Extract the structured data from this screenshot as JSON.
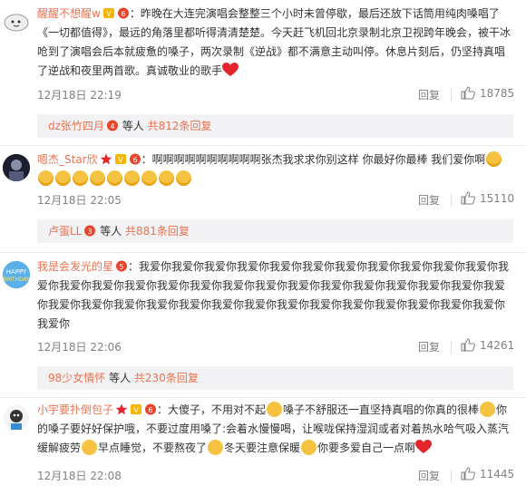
{
  "comments": [
    {
      "user": "醒醒不想醒w",
      "text1": "：昨晚在大连完演唱会整整三个小时未曾停歇，最后还放下话筒用纯肉嗓唱了《一切都值得》，最远的角落里都听得清清楚楚。今天赶飞机回北京录制北京卫视跨年晚会，被干冰呛到了演唱会后本就疲惫的嗓子，两次录制《逆战》都不满意主动叫停。休息片刻后，仍坚持真唱了逆战和夜里两首歌。真诚敬业的歌手",
      "time": "12月18日 22:19",
      "reply": "回复",
      "likes": "18785",
      "sub": {
        "name": "dz张竹四月",
        "mid": " 等人 ",
        "count": "共812条回复"
      }
    },
    {
      "user": "嗯杰_Star欣",
      "text1": "：啊啊啊啊啊啊啊啊啊啊张杰我求求你别这样 你最好你最棒 我们爱你啊",
      "time": "12月18日 22:05",
      "reply": "回复",
      "likes": "15110",
      "sub": {
        "name": "卢蛋LL",
        "mid": " 等人 ",
        "count": "共881条回复"
      }
    },
    {
      "user": "我是会发光的星",
      "text1": "：我爱你我爱你我爱你我爱你我爱你我爱你我爱你我爱你我爱你我爱你我爱你我爱你我爱你我爱你我爱你我爱你我爱你我爱你我爱你我爱你我爱你我爱你我爱你我爱你我爱你我爱你我爱你我爱你我爱你我爱你我爱你我爱你我爱你我爱你我爱你我爱你我爱你我爱你我爱你我爱你我爱你",
      "time": "12月18日 22:06",
      "reply": "回复",
      "likes": "14261",
      "sub": {
        "name": "98少女情怀",
        "mid": " 等人 ",
        "count": "共230条回复"
      }
    },
    {
      "user": "小宇要扑倒包子",
      "text1": "：大傻子，不用对不起",
      "text2": "嗓子不舒服还一直坚持真唱的你真的很棒",
      "text3": "你的嗓子要好好保护哦，不要过度用嗓了:会着水慢慢喝，让喉咙保持湿润或者对着热水哈气吸入蒸汽缓解疲劳",
      "text4": "早点睡觉，不要熬夜了",
      "text5": "冬天要注意保暖",
      "text6": "你要多爱自己一点啊",
      "time": "12月18日 22:08",
      "reply": "回复",
      "likes": "11445"
    }
  ],
  "colors": {
    "accent": "#eb7350",
    "muted": "#808080",
    "subbg": "#f2f2f5"
  }
}
